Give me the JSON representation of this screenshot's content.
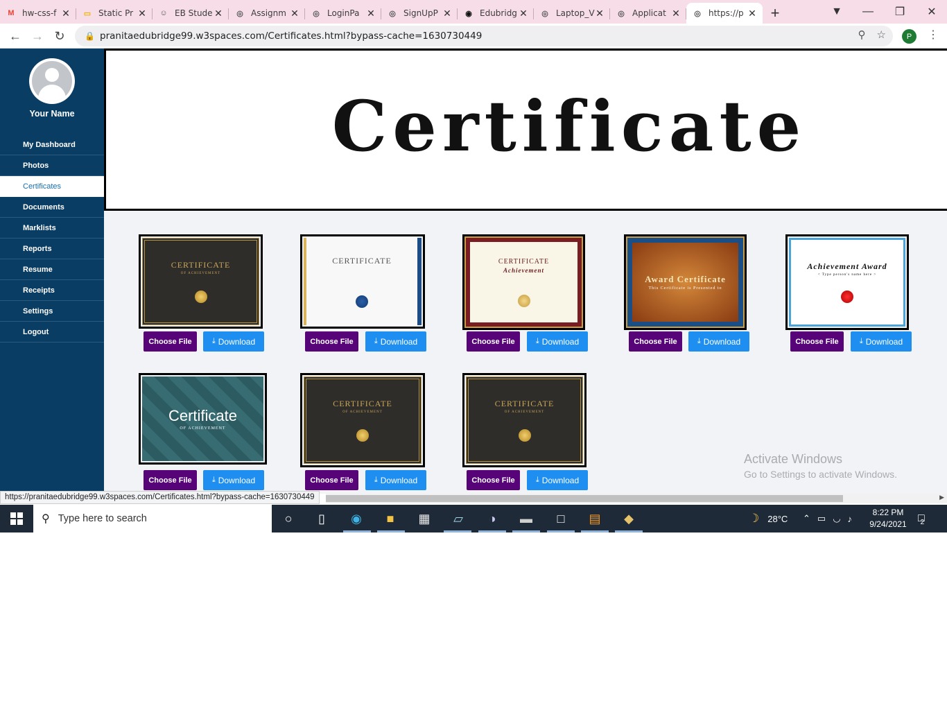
{
  "browser": {
    "tabs": [
      {
        "title": "hw-css-f",
        "icon": "gmail-icon",
        "color": "#ea4335"
      },
      {
        "title": "Static Pr",
        "icon": "slides-icon",
        "color": "#f4b400"
      },
      {
        "title": "EB Stude",
        "icon": "person-icon",
        "color": "#555555"
      },
      {
        "title": "Assignm",
        "icon": "globe-icon",
        "color": "#555555"
      },
      {
        "title": "LoginPa",
        "icon": "globe-icon",
        "color": "#555555"
      },
      {
        "title": "SignUpP",
        "icon": "globe-icon",
        "color": "#555555"
      },
      {
        "title": "Edubridg",
        "icon": "github-icon",
        "color": "#111111"
      },
      {
        "title": "Laptop_V",
        "icon": "globe-icon",
        "color": "#555555"
      },
      {
        "title": "Applicat",
        "icon": "globe-icon",
        "color": "#555555"
      },
      {
        "title": "https://p",
        "icon": "globe-icon",
        "color": "#555555"
      }
    ],
    "url": "pranitaedubridge99.w3spaces.com/Certificates.html?bypass-cache=1630730449",
    "profile_initial": "P",
    "status_url": "https://pranitaedubridge99.w3spaces.com/Certificates.html?bypass-cache=1630730449"
  },
  "sidebar": {
    "user_name": "Your Name",
    "items": [
      {
        "label": "My Dashboard"
      },
      {
        "label": "Photos"
      },
      {
        "label": "Certificates",
        "active": true
      },
      {
        "label": "Documents"
      },
      {
        "label": "Marklists"
      },
      {
        "label": "Reports"
      },
      {
        "label": "Resume"
      },
      {
        "label": "Receipts"
      },
      {
        "label": "Settings"
      },
      {
        "label": "Logout"
      }
    ]
  },
  "banner": {
    "title": "Certificate"
  },
  "certificates": [
    {
      "style": "dark",
      "title": "CERTIFICATE",
      "subtitle": "OF ACHIEVEMENT"
    },
    {
      "style": "white",
      "title": "CERTIFICATE",
      "subtitle": ""
    },
    {
      "style": "ornate",
      "title": "CERTIFICATE",
      "subtitle": "Achievement"
    },
    {
      "style": "award",
      "title": "Award Certificate",
      "subtitle": "This Certificate is Presented to"
    },
    {
      "style": "achieve",
      "title": "Achievement Award",
      "subtitle": "< Type person's name here >"
    },
    {
      "style": "teal",
      "title": "Certificate",
      "subtitle": "OF ACHIEVEMENT"
    },
    {
      "style": "dark",
      "title": "CERTIFICATE",
      "subtitle": "OF ACHIEVEMENT"
    },
    {
      "style": "dark",
      "title": "CERTIFICATE",
      "subtitle": "OF ACHIEVEMENT"
    }
  ],
  "buttons": {
    "choose_file": "Choose File",
    "download": "Download"
  },
  "watermark": {
    "line1": "Activate Windows",
    "line2": "Go to Settings to activate Windows."
  },
  "taskbar": {
    "search_placeholder": "Type here to search",
    "weather": "28°C",
    "time": "8:22 PM",
    "date": "9/24/2021",
    "notifications": "2"
  }
}
